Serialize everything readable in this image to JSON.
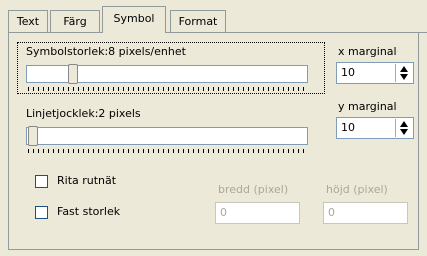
{
  "tabs": [
    {
      "label": "Text",
      "active": false
    },
    {
      "label": "Färg",
      "active": false
    },
    {
      "label": "Symbol",
      "active": true
    },
    {
      "label": "Format",
      "active": false
    }
  ],
  "symbol_size": {
    "label": "Symbolstorlek:8 pixels/enhet",
    "level": 0.15
  },
  "line_thickness": {
    "label": "Linjetjocklek:2 pixels",
    "level": 0.0
  },
  "x_margin": {
    "label": "x marginal",
    "value": "10"
  },
  "y_margin": {
    "label": "y marginal",
    "value": "10"
  },
  "draw_grid": {
    "label": "Rita rutnät",
    "checked": false
  },
  "fixed_size": {
    "label": "Fast storlek",
    "checked": false
  },
  "width_field": {
    "label": "bredd (pixel)",
    "value": "0"
  },
  "height_field": {
    "label": "höjd (pixel)",
    "value": "0"
  }
}
